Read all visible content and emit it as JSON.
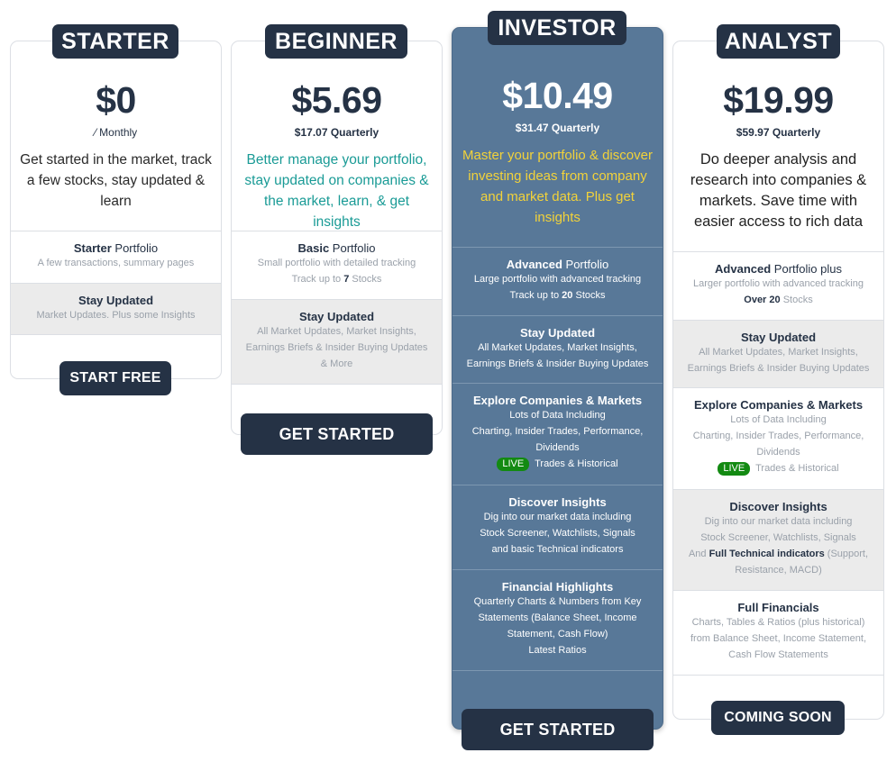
{
  "plans": [
    {
      "title": "STARTER",
      "price": "$0",
      "sub": "⁄ Monthly",
      "description": "Get started in the market, track a few stocks, stay updated & learn",
      "sections": [
        {
          "title_bold": "Starter",
          "title_rest": " Portfolio",
          "lines": [
            "A few transactions, summary pages"
          ]
        },
        {
          "title_bold": "Stay Updated",
          "title_rest": "",
          "lines": [
            "Market Updates. Plus some Insights"
          ]
        }
      ],
      "button": "START FREE"
    },
    {
      "title": "BEGINNER",
      "price": "$5.69",
      "sub": "$17.07 Quarterly",
      "description": "Better manage your portfolio, stay updated on companies & the market, learn, & get insights",
      "sections": [
        {
          "title_bold": "Basic",
          "title_rest": " Portfolio",
          "lines": [
            "Small portfolio with detailed tracking"
          ],
          "track_pre": "Track up to ",
          "track_bold": "7",
          "track_post": " Stocks"
        },
        {
          "title_bold": "Stay Updated",
          "title_rest": "",
          "lines": [
            "All Market Updates, Market Insights,",
            "Earnings Briefs & Insider Buying Updates",
            "& More"
          ]
        }
      ],
      "button": "GET STARTED"
    },
    {
      "title": "INVESTOR",
      "price": "$10.49",
      "sub": "$31.47 Quarterly",
      "description": "Master your portfolio & discover investing ideas from company and market data. Plus get insights",
      "sections": [
        {
          "title_bold": "Advanced",
          "title_rest": " Portfolio",
          "lines": [
            "Large portfolio with advanced tracking"
          ],
          "track_pre": "Track up to ",
          "track_bold": "20",
          "track_post": " Stocks"
        },
        {
          "title_bold": "Stay Updated",
          "title_rest": "",
          "lines": [
            "All Market Updates, Market Insights,",
            "Earnings Briefs & Insider Buying Updates"
          ]
        },
        {
          "title_bold": "Explore Companies & Markets",
          "title_rest": "",
          "lines": [
            "Lots of Data Including",
            "Charting, Insider Trades, Performance,",
            "Dividends"
          ],
          "live": "LIVE",
          "live_text": " Trades & Historical"
        },
        {
          "title_bold": "Discover Insights",
          "title_rest": "",
          "lines": [
            "Dig into our market data including",
            "Stock Screener, Watchlists, Signals",
            "and basic Technical indicators"
          ]
        },
        {
          "title_bold": "Financial Highlights",
          "title_rest": "",
          "lines": [
            "Quarterly Charts & Numbers from Key",
            "Statements (Balance Sheet, Income",
            "Statement, Cash Flow)",
            "Latest Ratios"
          ]
        }
      ],
      "button": "GET STARTED"
    },
    {
      "title": "ANALYST",
      "price": "$19.99",
      "sub": "$59.97 Quarterly",
      "description": "Do deeper analysis and research into companies & markets. Save time with easier access to rich data",
      "sections": [
        {
          "title_bold": "Advanced",
          "title_rest": " Portfolio plus",
          "lines": [
            "Larger portfolio with advanced tracking"
          ],
          "track_pre": "",
          "track_bold": "Over 20",
          "track_post": " Stocks"
        },
        {
          "title_bold": "Stay Updated",
          "title_rest": "",
          "lines": [
            "All Market Updates, Market Insights,",
            "Earnings Briefs & Insider Buying Updates"
          ]
        },
        {
          "title_bold": "Explore Companies & Markets",
          "title_rest": "",
          "lines": [
            "Lots of Data Including",
            "Charting, Insider Trades, Performance,",
            "Dividends"
          ],
          "live": "LIVE",
          "live_text": " Trades & Historical"
        },
        {
          "title_bold": "Discover Insights",
          "title_rest": "",
          "lines": [
            "Dig into our market data including",
            "Stock Screener, Watchlists, Signals"
          ],
          "adv_pre": "And ",
          "adv_bold": "Full Technical indicators",
          "adv_post": " (Support,",
          "adv_last": "Resistance, MACD)"
        },
        {
          "title_bold": "Full Financials",
          "title_rest": "",
          "lines": [
            "Charts, Tables & Ratios (plus historical)",
            "from Balance Sheet, Income Statement,",
            "Cash Flow Statements"
          ]
        }
      ],
      "button": "COMING SOON"
    }
  ],
  "colors": {
    "navy": "#253245",
    "investor_bg": "#587898",
    "teal": "#1a9b96",
    "gold": "#f2d23a",
    "live_green": "#138a12",
    "grey_section": "#ebebeb"
  }
}
